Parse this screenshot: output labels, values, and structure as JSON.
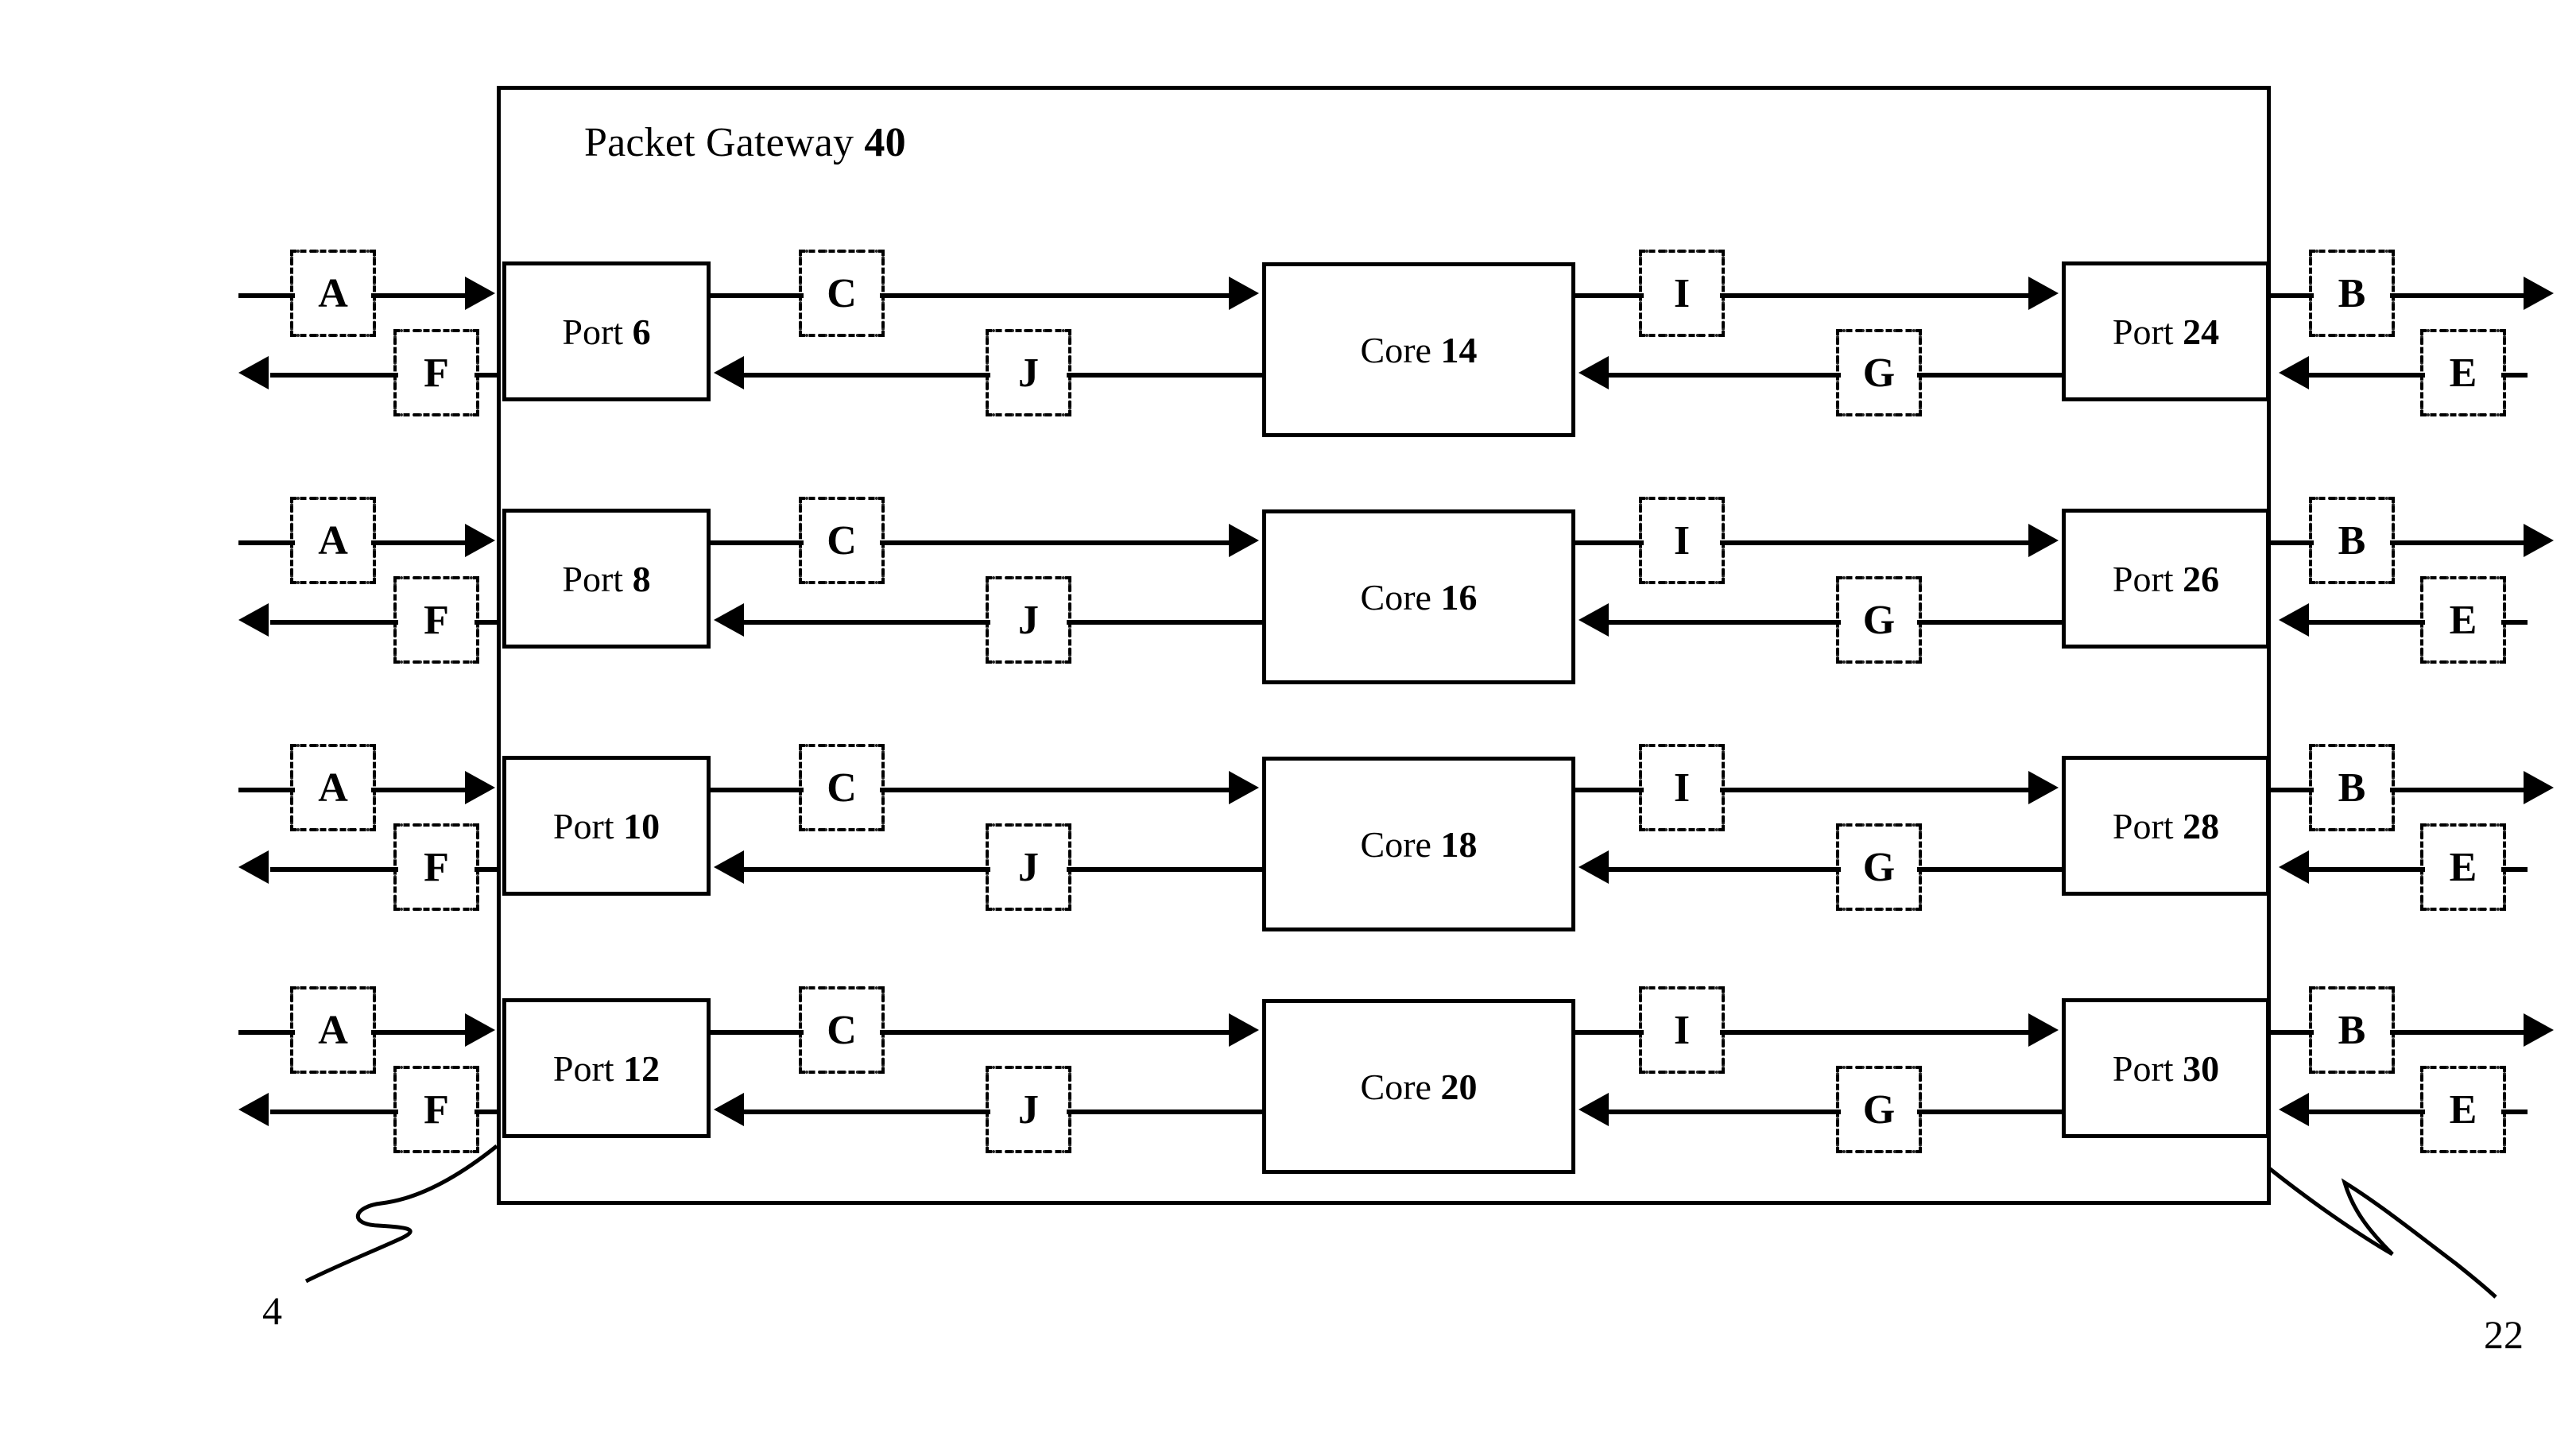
{
  "figure": {
    "gateway_label_text": "Packet Gateway",
    "gateway_label_number": "40",
    "left_ref": "4",
    "right_ref": "22"
  },
  "rows": [
    {
      "port_in": {
        "text": "Port",
        "number": "6"
      },
      "core": {
        "text": "Core",
        "number": "14"
      },
      "port_out": {
        "text": "Port",
        "number": "24"
      },
      "tags": {
        "ingress_outside": "A",
        "egress_outside": "F",
        "ingress_inside": "C",
        "egress_inside": "J",
        "core_out": "I",
        "core_in": "G",
        "far_egress": "B",
        "far_ingress": "E"
      }
    },
    {
      "port_in": {
        "text": "Port",
        "number": "8"
      },
      "core": {
        "text": "Core",
        "number": "16"
      },
      "port_out": {
        "text": "Port",
        "number": "26"
      },
      "tags": {
        "ingress_outside": "A",
        "egress_outside": "F",
        "ingress_inside": "C",
        "egress_inside": "J",
        "core_out": "I",
        "core_in": "G",
        "far_egress": "B",
        "far_ingress": "E"
      }
    },
    {
      "port_in": {
        "text": "Port",
        "number": "10"
      },
      "core": {
        "text": "Core",
        "number": "18"
      },
      "port_out": {
        "text": "Port",
        "number": "28"
      },
      "tags": {
        "ingress_outside": "A",
        "egress_outside": "F",
        "ingress_inside": "C",
        "egress_inside": "J",
        "core_out": "I",
        "core_in": "G",
        "far_egress": "B",
        "far_ingress": "E"
      }
    },
    {
      "port_in": {
        "text": "Port",
        "number": "12"
      },
      "core": {
        "text": "Core",
        "number": "20"
      },
      "port_out": {
        "text": "Port",
        "number": "30"
      },
      "tags": {
        "ingress_outside": "A",
        "egress_outside": "F",
        "ingress_inside": "C",
        "egress_inside": "J",
        "core_out": "I",
        "core_in": "G",
        "far_egress": "B",
        "far_ingress": "E"
      }
    }
  ]
}
